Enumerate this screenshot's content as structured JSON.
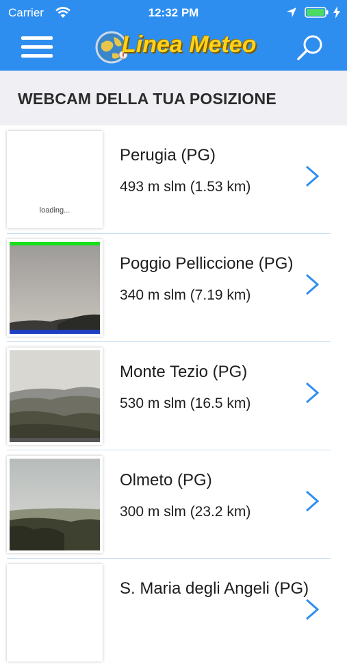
{
  "status_bar": {
    "carrier": "Carrier",
    "time": "12:32 PM"
  },
  "header": {
    "app_title": "Linea Meteo",
    "menu_icon": "hamburger-menu-icon",
    "search_icon": "search-icon",
    "accent_color": "#2e8ef0"
  },
  "section": {
    "title": "WEBCAM DELLA TUA POSIZIONE"
  },
  "webcams": [
    {
      "name": "Perugia (PG)",
      "distance": "493 m slm (1.53 km)",
      "thumb_text": "loading..."
    },
    {
      "name": "Poggio Pelliccione (PG)",
      "distance": "340 m slm (7.19 km)"
    },
    {
      "name": "Monte Tezio (PG)",
      "distance": "530 m slm (16.5 km)"
    },
    {
      "name": "Olmeto (PG)",
      "distance": "300 m slm (23.2 km)"
    },
    {
      "name": "S. Maria degli Angeli (PG)",
      "distance": ""
    }
  ]
}
